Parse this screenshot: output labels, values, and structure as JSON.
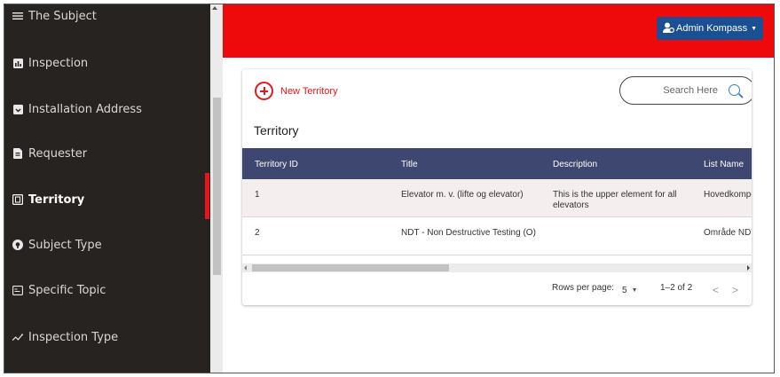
{
  "sidebar": {
    "items": [
      {
        "label": "The Subject",
        "icon": "menu-lines-icon",
        "active": false
      },
      {
        "label": "Inspection",
        "icon": "chart-icon",
        "active": false
      },
      {
        "label": "Installation Address",
        "icon": "address-icon",
        "active": false
      },
      {
        "label": "Requester",
        "icon": "document-icon",
        "active": false
      },
      {
        "label": "Territory",
        "icon": "territory-icon",
        "active": true
      },
      {
        "label": "Subject Type",
        "icon": "shield-icon",
        "active": false
      },
      {
        "label": "Specific Topic",
        "icon": "topic-icon",
        "active": false
      },
      {
        "label": "Inspection Type",
        "icon": "pulse-icon",
        "active": false
      }
    ]
  },
  "topbar": {
    "user_label": "Admin Kompass",
    "color": "#ee0a0a",
    "user_button_color": "#1a4f93"
  },
  "toolbar": {
    "new_label": "New Territory",
    "search_placeholder": "Search Here"
  },
  "main": {
    "title": "Territory"
  },
  "table": {
    "headers": [
      "Territory ID",
      "Title",
      "Description",
      "List Name"
    ],
    "rows": [
      {
        "id": "1",
        "title": "Elevator m. v. (lifte og elevator)",
        "description": "This is the upper element for all elevators",
        "list_name": "Hovedkompo"
      },
      {
        "id": "2",
        "title": "NDT - Non Destructive Testing (O)",
        "description": "",
        "list_name": "Område NDT"
      }
    ],
    "header_color": "#3e4770"
  },
  "pagination": {
    "rows_per_page_label": "Rows per page:",
    "rows_per_page_value": "5",
    "range": "1–2 of 2"
  }
}
